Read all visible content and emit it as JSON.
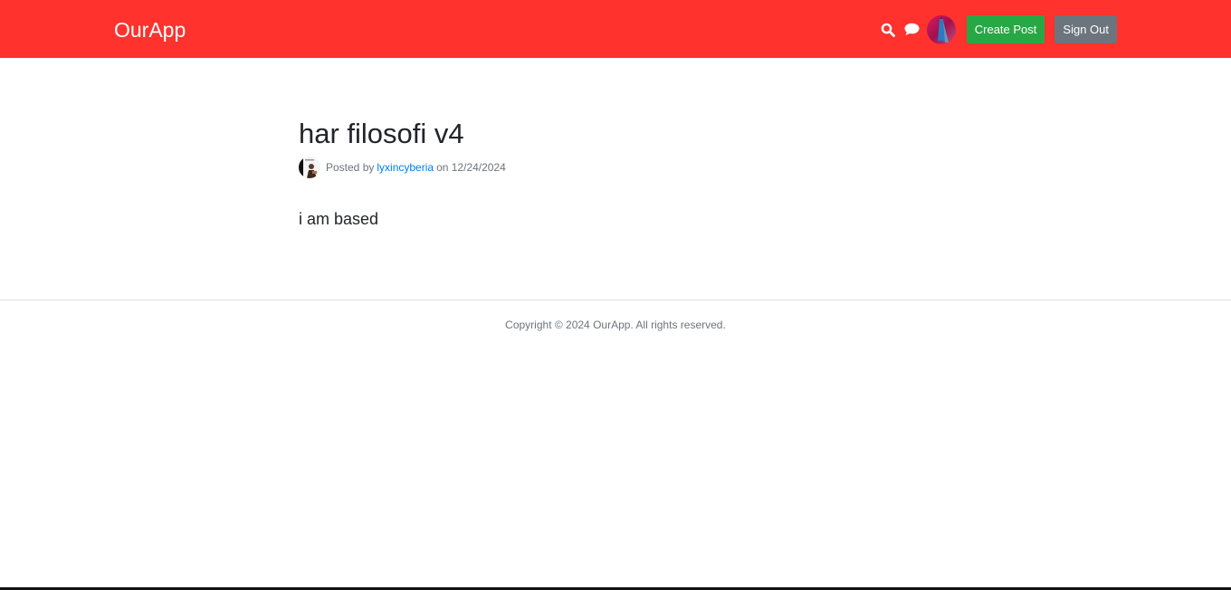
{
  "header": {
    "brand": "OurApp",
    "create_post_label": "Create Post",
    "sign_out_label": "Sign Out",
    "bg_color": "#ff322e",
    "icons": [
      "search-icon",
      "chat-icon"
    ]
  },
  "post": {
    "title": "har filosofi v4",
    "posted_by_prefix": "Posted by",
    "author": "lyxincyberia",
    "date_text": "on 12/24/2024",
    "body": "i am based"
  },
  "footer": {
    "copyright": "Copyright © 2024 OurApp. All rights reserved."
  }
}
